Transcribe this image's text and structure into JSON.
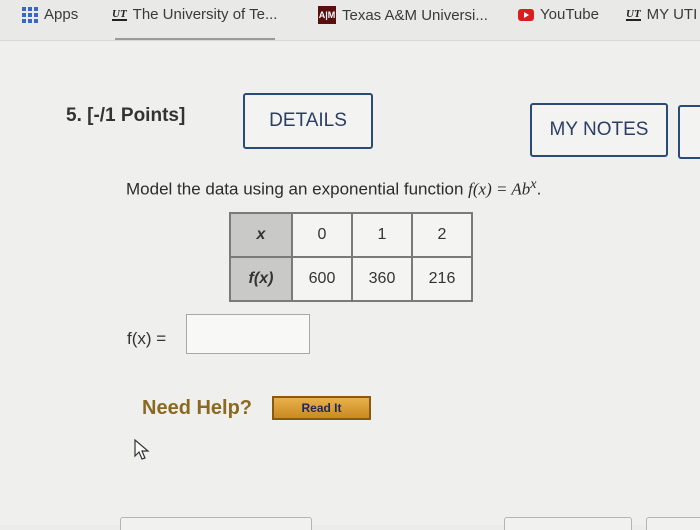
{
  "bookmarks": {
    "apps": "Apps",
    "items": [
      {
        "label": "The University of Te...",
        "icon": "ut-logo-icon"
      },
      {
        "label": "Texas A&M Universi...",
        "icon": "tamu-logo-icon"
      },
      {
        "label": "YouTube",
        "icon": "youtube-icon"
      },
      {
        "label": "MY UTI",
        "icon": "ut-logo-icon"
      }
    ],
    "ut_logo_text": "UT",
    "tamu_logo_text": "A|M"
  },
  "question": {
    "number": "5. [-/1 Points]",
    "details_label": "DETAILS",
    "my_notes_label": "MY NOTES",
    "prompt_text": "Model the data using an exponential function ",
    "prompt_formula": "f(x) = Ab",
    "prompt_exponent": "x",
    "prompt_end": ".",
    "table": {
      "row_x_header": "x",
      "row_fx_header": "f(x)",
      "x_values": [
        "0",
        "1",
        "2"
      ],
      "fx_values": [
        "600",
        "360",
        "216"
      ]
    },
    "answer_label": "f(x) =",
    "answer_value": ""
  },
  "help": {
    "need_help_label": "Need Help?",
    "read_it_label": "Read It"
  },
  "colors": {
    "accent_border": "#2c4a78",
    "need_help": "#8a6a22",
    "read_it_bg": "#d99a32"
  }
}
